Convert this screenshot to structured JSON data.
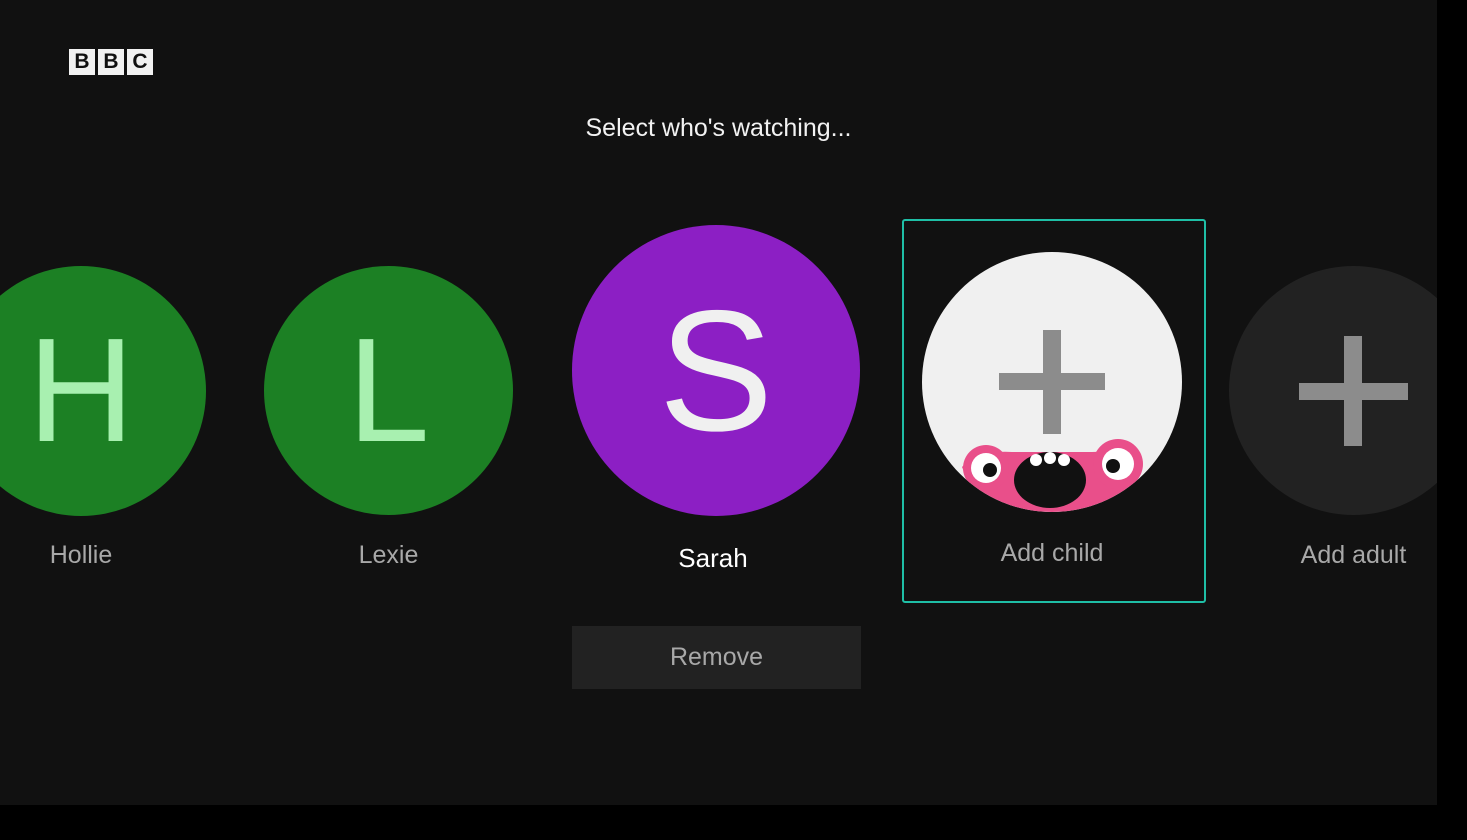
{
  "logo": {
    "letters": [
      "B",
      "B",
      "C"
    ]
  },
  "heading": "Select who's watching...",
  "profiles": [
    {
      "initial": "H",
      "name": "Hollie",
      "color": "#1c8024",
      "letter_color": "#a8f0b0"
    },
    {
      "initial": "L",
      "name": "Lexie",
      "color": "#1c8024",
      "letter_color": "#a8f0b0"
    },
    {
      "initial": "S",
      "name": "Sarah",
      "color": "#8c1fc4",
      "letter_color": "#f0f0f0"
    }
  ],
  "add_child": {
    "label": "Add child",
    "icon": "plus-icon",
    "mascot": "monster-face-icon"
  },
  "add_adult": {
    "label": "Add adult",
    "icon": "plus-icon"
  },
  "remove_button": "Remove",
  "colors": {
    "background": "#111111",
    "focus_outline": "#1fbfa6",
    "selected_text": "#ffffff",
    "muted_text": "#a8a8a8"
  }
}
